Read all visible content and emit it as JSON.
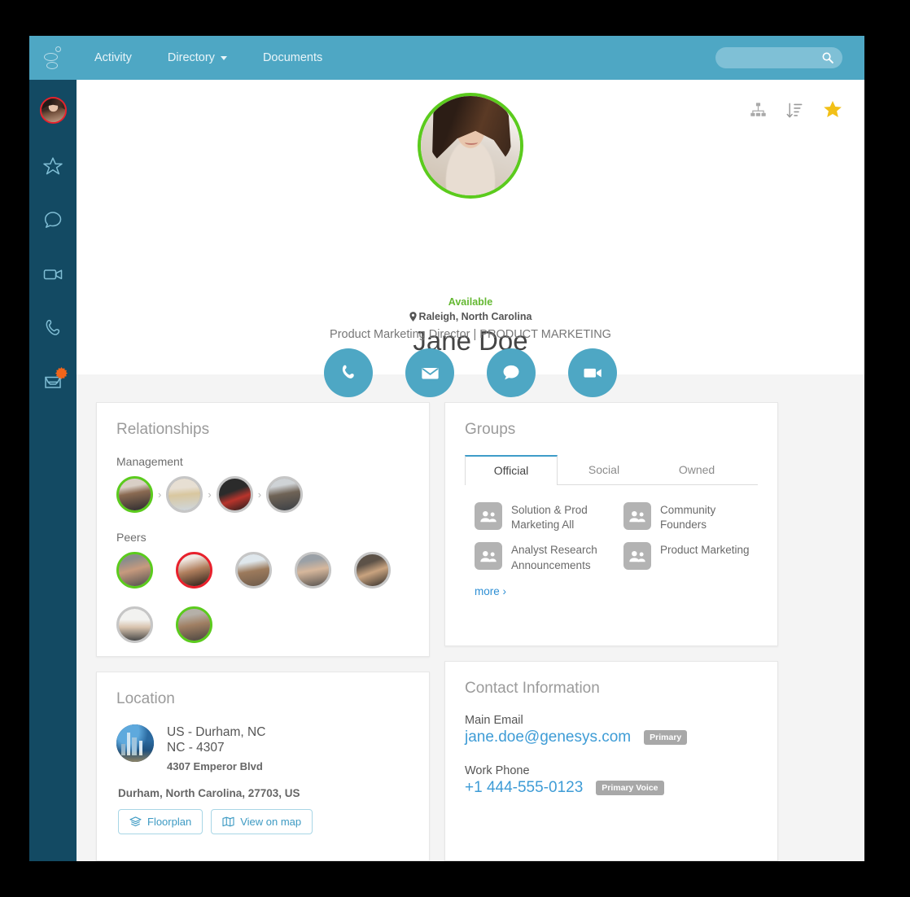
{
  "theme": {
    "header_bg": "#4ea7c4",
    "rail_bg": "#134a63",
    "accent_blue": "#3e9cd6",
    "status_green": "#64b832",
    "ring_green": "#5bcb1d",
    "ring_red": "#e8212c",
    "badge_orange": "#f2651a",
    "star_gold": "#f2c017",
    "page_bg": "#f4f4f4"
  },
  "header": {
    "logo_name": "genesys-logo",
    "nav": [
      {
        "label": "Activity",
        "has_caret": false
      },
      {
        "label": "Directory",
        "has_caret": true
      },
      {
        "label": "Documents",
        "has_caret": false
      }
    ],
    "search": {
      "value": "",
      "placeholder": "",
      "icon": "search-icon"
    }
  },
  "rail": {
    "items": [
      {
        "name": "profile-avatar",
        "icon": "user-avatar",
        "ring": "#e8212c",
        "badge": null
      },
      {
        "name": "favorites",
        "icon": "star-outline-icon",
        "badge": null
      },
      {
        "name": "chat",
        "icon": "chat-bubble-icon",
        "badge": null
      },
      {
        "name": "video",
        "icon": "video-camera-icon",
        "badge": null
      },
      {
        "name": "calls",
        "icon": "phone-handset-icon",
        "badge": null
      },
      {
        "name": "inbox",
        "icon": "inbox-tray-icon",
        "badge": "new-items-burst"
      }
    ]
  },
  "profile": {
    "avatar_name": "profile-photo",
    "status": "Available",
    "location_line": "Raleigh, North Carolina",
    "name": "Jane Doe",
    "title": "Product Marketing Director | PRODUCT MARKETING",
    "head_actions": [
      {
        "name": "org-chart-button",
        "icon": "org-chart-icon"
      },
      {
        "name": "sort-button",
        "icon": "sort-descending-icon"
      },
      {
        "name": "favorite-button",
        "icon": "star-filled-icon"
      }
    ],
    "contact_actions": [
      {
        "name": "call-button",
        "icon": "phone-icon"
      },
      {
        "name": "email-button",
        "icon": "envelope-icon"
      },
      {
        "name": "chat-button",
        "icon": "chat-icon"
      },
      {
        "name": "video-button",
        "icon": "video-icon"
      }
    ]
  },
  "relationships": {
    "title": "Relationships",
    "management_label": "Management",
    "management": [
      {
        "name": "manager-avatar-1",
        "ring": "green"
      },
      {
        "name": "manager-avatar-2",
        "ring": "gray"
      },
      {
        "name": "manager-avatar-3",
        "ring": "gray"
      },
      {
        "name": "manager-avatar-4",
        "ring": "gray"
      }
    ],
    "separator": "›",
    "peers_label": "Peers",
    "peers": [
      {
        "name": "peer-avatar-1",
        "ring": "green"
      },
      {
        "name": "peer-avatar-2",
        "ring": "red"
      },
      {
        "name": "peer-avatar-3",
        "ring": "gray"
      },
      {
        "name": "peer-avatar-4",
        "ring": "gray"
      },
      {
        "name": "peer-avatar-5",
        "ring": "gray"
      },
      {
        "name": "peer-avatar-6",
        "ring": "gray"
      },
      {
        "name": "peer-avatar-7",
        "ring": "green"
      }
    ]
  },
  "groups": {
    "title": "Groups",
    "tabs": [
      {
        "label": "Official",
        "active": true
      },
      {
        "label": "Social",
        "active": false
      },
      {
        "label": "Owned",
        "active": false
      }
    ],
    "items": [
      {
        "label": "Solution & Prod Marketing All",
        "icon": "group-icon"
      },
      {
        "label": "Community Founders",
        "icon": "group-icon"
      },
      {
        "label": "Analyst Research Announcements",
        "icon": "group-icon"
      },
      {
        "label": "Product Marketing",
        "icon": "group-icon"
      }
    ],
    "more_label": "more ›"
  },
  "location": {
    "title": "Location",
    "thumb_name": "city-photo",
    "line1": "US - Durham, NC",
    "line2": "NC - 4307",
    "street": "4307 Emperor Blvd",
    "full_address": "Durham, North Carolina, 27703, US",
    "buttons": [
      {
        "label": "Floorplan",
        "icon": "layers-icon"
      },
      {
        "label": "View on map",
        "icon": "map-icon"
      }
    ]
  },
  "contact": {
    "title": "Contact Information",
    "email_label": "Main Email",
    "email_value": "jane.doe@genesys.com",
    "email_badge": "Primary",
    "phone_label": "Work Phone",
    "phone_value": "+1 444-555-0123",
    "phone_badge": "Primary Voice"
  }
}
